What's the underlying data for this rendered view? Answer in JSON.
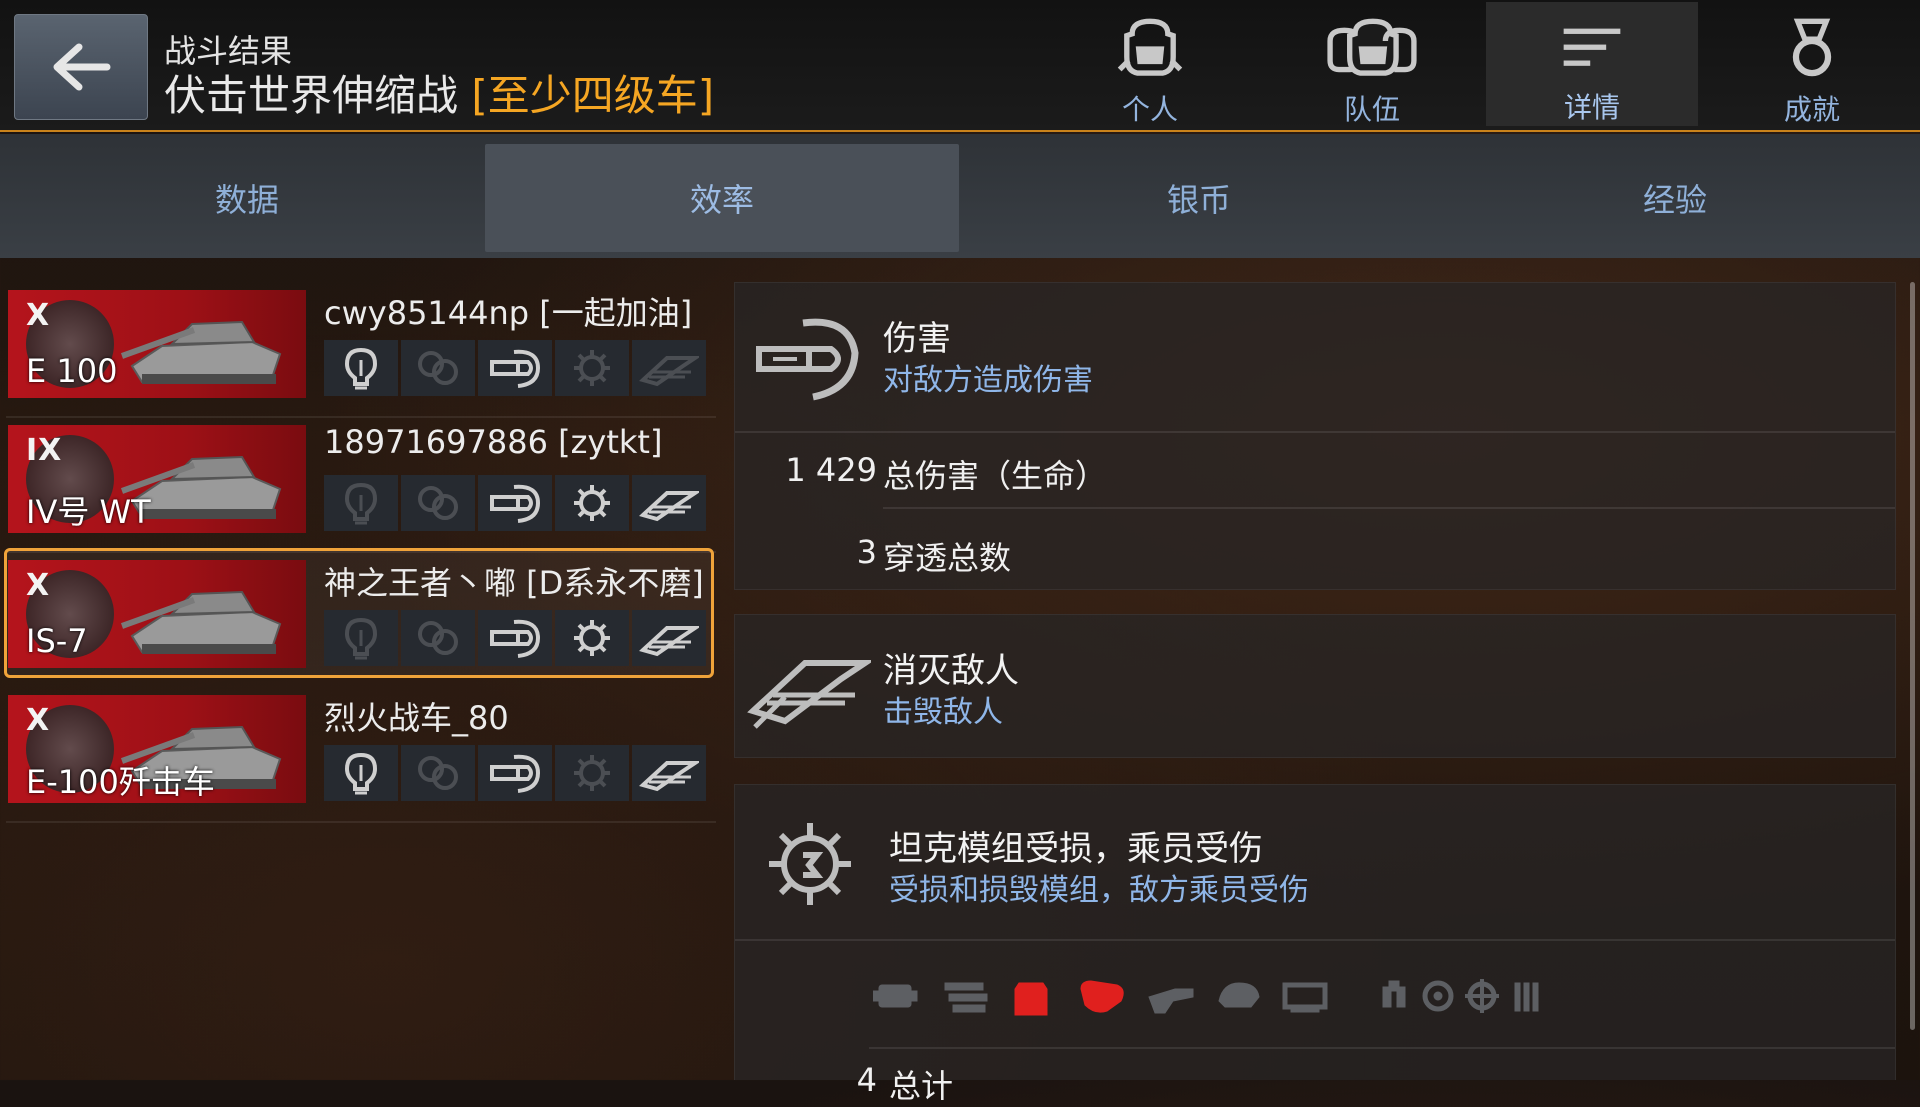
{
  "header": {
    "back_label": "back",
    "subtitle": "战斗结果",
    "title": "伏击世界伸缩战",
    "tag": "[至少四级车]",
    "tabs": [
      {
        "label": "个人",
        "icon": "single-helmet-icon"
      },
      {
        "label": "队伍",
        "icon": "team-helmets-icon"
      },
      {
        "label": "详情",
        "icon": "details-list-icon"
      },
      {
        "label": "成就",
        "icon": "medal-icon"
      }
    ],
    "active_tab": "详情"
  },
  "subtabs": {
    "items": [
      "数据",
      "效率",
      "银币",
      "经验"
    ],
    "active": "效率"
  },
  "players": [
    {
      "tier": "X",
      "tank": "E 100",
      "name": "cwy85144np [一起加油]",
      "badges": [
        true,
        false,
        true,
        false,
        false
      ]
    },
    {
      "tier": "IX",
      "tank": "IV号 WT",
      "name": "18971697886 [zytkt]",
      "badges": [
        false,
        false,
        true,
        true,
        true
      ]
    },
    {
      "tier": "X",
      "tank": "IS-7",
      "name": "神之王者丶嘟 [D系永不磨]",
      "badges": [
        false,
        false,
        true,
        true,
        true
      ],
      "selected": true
    },
    {
      "tier": "X",
      "tank": "E-100歼击车",
      "name": "烈火战车_80",
      "badges": [
        true,
        false,
        true,
        false,
        true
      ]
    }
  ],
  "badge_icons": [
    "spot-bulb-icon",
    "assist-link-icon",
    "damage-shell-icon",
    "module-gear-icon",
    "kill-wings-icon"
  ],
  "damage_panel": {
    "title": "伤害",
    "subtitle": "对敌方造成伤害",
    "stats": [
      {
        "value": "1 429",
        "label": "总伤害（生命）"
      },
      {
        "value": "3",
        "label": "穿透总数"
      }
    ]
  },
  "kills_panel": {
    "title": "消灭敌人",
    "subtitle": "击毁敌人"
  },
  "modules_panel": {
    "title": "坦克模组受损，乘员受伤",
    "subtitle": "受损和损毁模组，敌方乘员受伤",
    "module_icons": [
      {
        "name": "engine-icon",
        "damaged": false
      },
      {
        "name": "transmission-icon",
        "damaged": false
      },
      {
        "name": "fuel-tank-icon",
        "damaged": true
      },
      {
        "name": "tracks-icon",
        "damaged": true
      },
      {
        "name": "gun-icon",
        "damaged": false
      },
      {
        "name": "turret-icon",
        "damaged": false
      },
      {
        "name": "ammo-rack-icon",
        "damaged": false
      },
      {
        "name": "commander-icon",
        "damaged": false
      },
      {
        "name": "driver-icon",
        "damaged": false
      },
      {
        "name": "gunner-icon",
        "damaged": false
      },
      {
        "name": "loader-icon",
        "damaged": false
      }
    ],
    "partial_row_value": "4",
    "partial_row_label": "总计"
  },
  "colors": {
    "accent": "#f5a623",
    "link": "#8fb6e8",
    "damaged": "#e0201e",
    "tank_card": "#b5141c"
  }
}
